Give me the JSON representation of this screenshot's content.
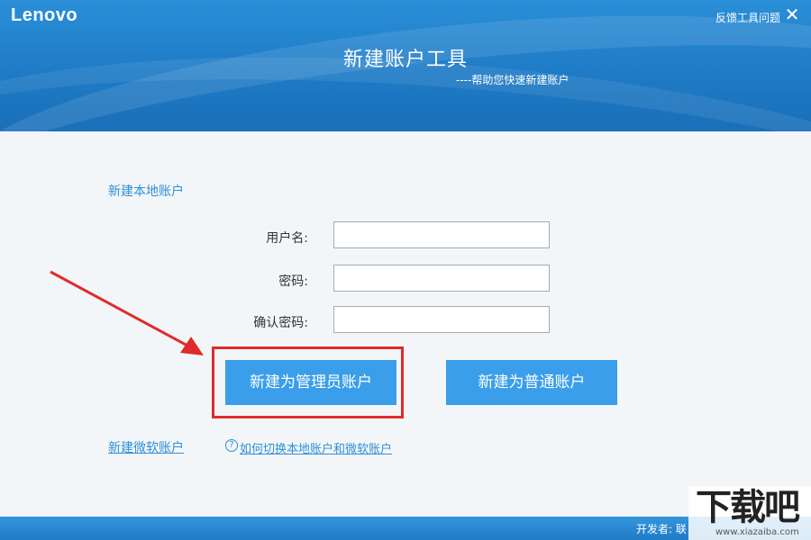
{
  "window": {
    "logo": "Lenovo",
    "feedback_label": "反馈工具问题",
    "close_symbol": "✕",
    "title": "新建账户工具",
    "subtitle": "----帮助您快速新建账户"
  },
  "form": {
    "section_title": "新建本地账户",
    "username_label": "用户名:",
    "username_value": "",
    "password_label": "密码:",
    "password_value": "",
    "confirm_label": "确认密码:",
    "confirm_value": ""
  },
  "actions": {
    "admin_button": "新建为管理员账户",
    "standard_button": "新建为普通账户"
  },
  "links": {
    "microsoft_account": "新建微软账户",
    "help_icon": "?",
    "switch_help": "如何切换本地账户和微软账户"
  },
  "footer": {
    "developer_text": "开发者: 联"
  },
  "watermark": {
    "text": "下载吧",
    "url": "www.xiazaiba.com"
  },
  "colors": {
    "header": "#1f7bc6",
    "button": "#3a9eea",
    "link": "#2f8fd6",
    "highlight": "#e12b2b"
  }
}
